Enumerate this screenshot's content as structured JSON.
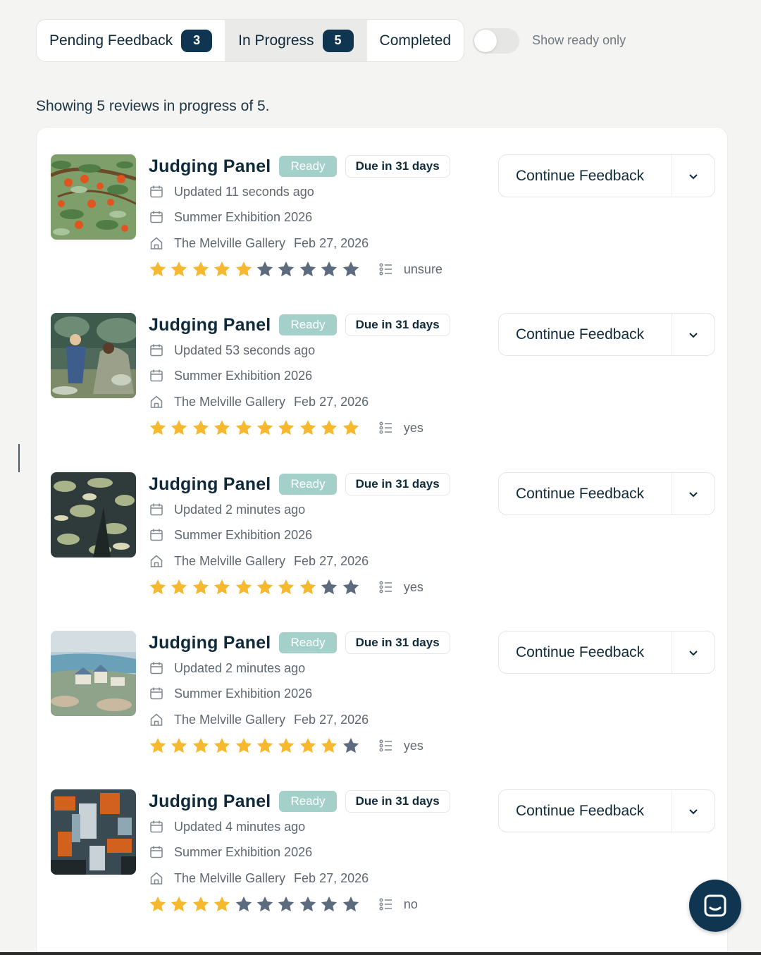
{
  "tabs": [
    {
      "label": "Pending Feedback",
      "count": "3"
    },
    {
      "label": "In Progress",
      "count": "5"
    },
    {
      "label": "Completed"
    }
  ],
  "toggle": {
    "label": "Show ready only",
    "on": false
  },
  "summary": "Showing 5 reviews in progress of 5.",
  "reviews": [
    {
      "title": "Judging Panel",
      "status": "Ready",
      "due": "Due in 31 days",
      "updated": "Updated 11 seconds ago",
      "exhibition": "Summer Exhibition 2026",
      "venue": "The Melville Gallery",
      "date": "Feb 27, 2026",
      "stars_filled": 5,
      "stars_total": 10,
      "recommendation": "unsure",
      "action": "Continue Feedback"
    },
    {
      "title": "Judging Panel",
      "status": "Ready",
      "due": "Due in 31 days",
      "updated": "Updated 53 seconds ago",
      "exhibition": "Summer Exhibition 2026",
      "venue": "The Melville Gallery",
      "date": "Feb 27, 2026",
      "stars_filled": 10,
      "stars_total": 10,
      "recommendation": "yes",
      "action": "Continue Feedback"
    },
    {
      "title": "Judging Panel",
      "status": "Ready",
      "due": "Due in 31 days",
      "updated": "Updated 2 minutes ago",
      "exhibition": "Summer Exhibition 2026",
      "venue": "The Melville Gallery",
      "date": "Feb 27, 2026",
      "stars_filled": 8,
      "stars_total": 10,
      "recommendation": "yes",
      "action": "Continue Feedback"
    },
    {
      "title": "Judging Panel",
      "status": "Ready",
      "due": "Due in 31 days",
      "updated": "Updated 2 minutes ago",
      "exhibition": "Summer Exhibition 2026",
      "venue": "The Melville Gallery",
      "date": "Feb 27, 2026",
      "stars_filled": 9,
      "stars_total": 10,
      "recommendation": "yes",
      "action": "Continue Feedback"
    },
    {
      "title": "Judging Panel",
      "status": "Ready",
      "due": "Due in 31 days",
      "updated": "Updated 4 minutes ago",
      "exhibition": "Summer Exhibition 2026",
      "venue": "The Melville Gallery",
      "date": "Feb 27, 2026",
      "stars_filled": 4,
      "stars_total": 10,
      "recommendation": "no",
      "action": "Continue Feedback"
    }
  ],
  "icons": {
    "updated": "calendar-icon",
    "exhibition": "calendar-icon",
    "venue": "home-icon",
    "recommendation": "list-icon",
    "action_menu": "chevron-down-icon",
    "chat": "chat-icon"
  },
  "colors": {
    "primary": "#0f3550",
    "ready_badge": "#a3d1c9",
    "star_filled": "#f5b82e",
    "star_empty": "#5c6b7d"
  }
}
